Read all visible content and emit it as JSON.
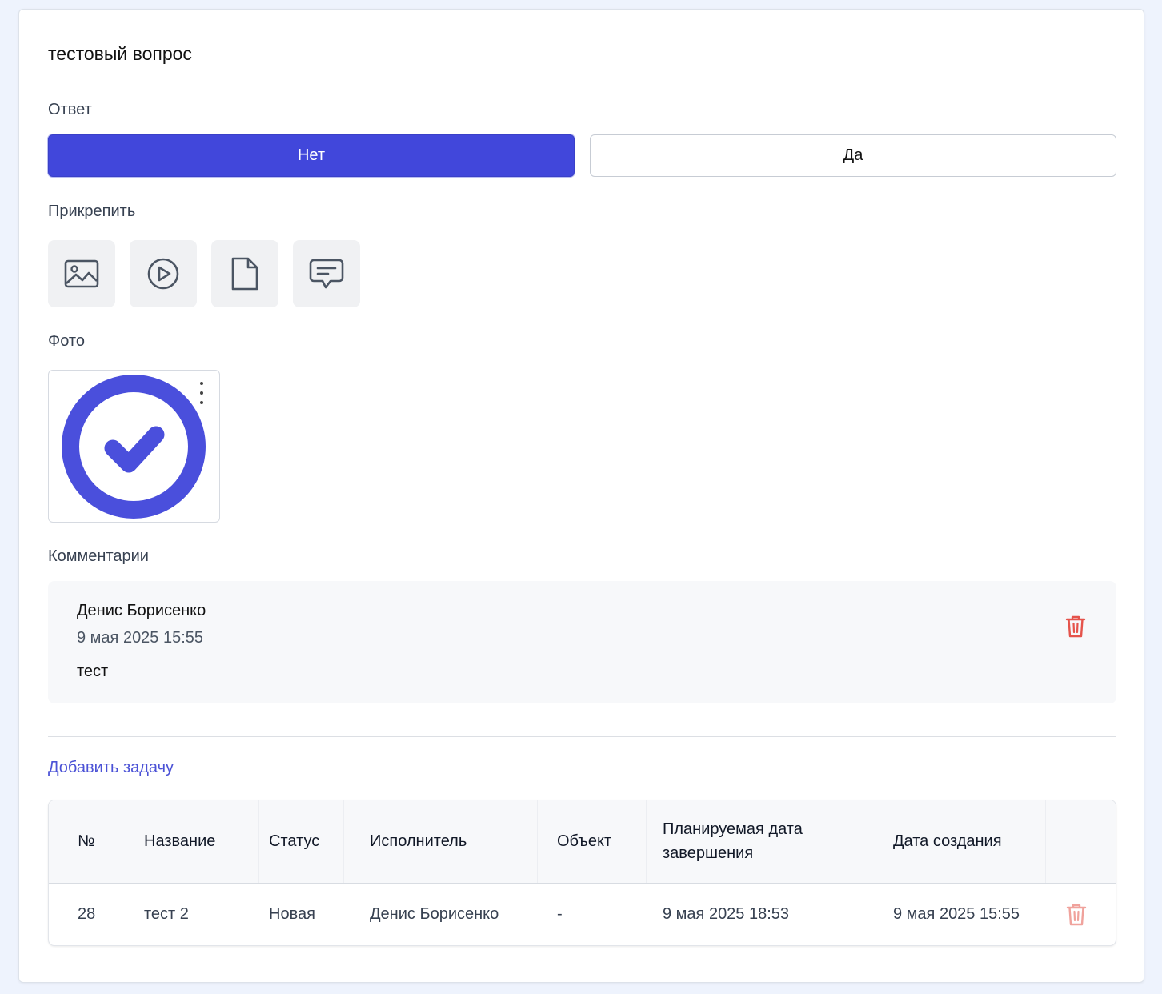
{
  "question": {
    "title": "тестовый вопрос"
  },
  "answer": {
    "label": "Ответ",
    "options": [
      {
        "label": "Нет",
        "selected": true
      },
      {
        "label": "Да",
        "selected": false
      }
    ],
    "accent_color": "#4147db"
  },
  "attach": {
    "label": "Прикрепить",
    "buttons": [
      {
        "icon": "image-icon"
      },
      {
        "icon": "video-play-icon"
      },
      {
        "icon": "file-icon"
      },
      {
        "icon": "comment-icon"
      }
    ]
  },
  "photo": {
    "label": "Фото",
    "thumbnail_icon": "checkmark-circle-icon",
    "thumbnail_color": "#4a4fdc"
  },
  "comments": {
    "label": "Комментарии",
    "items": [
      {
        "author": "Денис Борисенко",
        "date": "9 мая 2025 15:55",
        "text": "тест"
      }
    ],
    "delete_color": "#e5534b"
  },
  "tasks": {
    "add_label": "Добавить задачу",
    "columns": [
      "№",
      "Название",
      "Статус",
      "Исполнитель",
      "Объект",
      "Планируемая дата завершения",
      "Дата создания"
    ],
    "rows": [
      {
        "number": "28",
        "name": "тест 2",
        "status": "Новая",
        "assignee": "Денис Борисенко",
        "object": "-",
        "planned_end": "9 мая 2025 18:53",
        "created": "9 мая 2025 15:55"
      }
    ]
  }
}
